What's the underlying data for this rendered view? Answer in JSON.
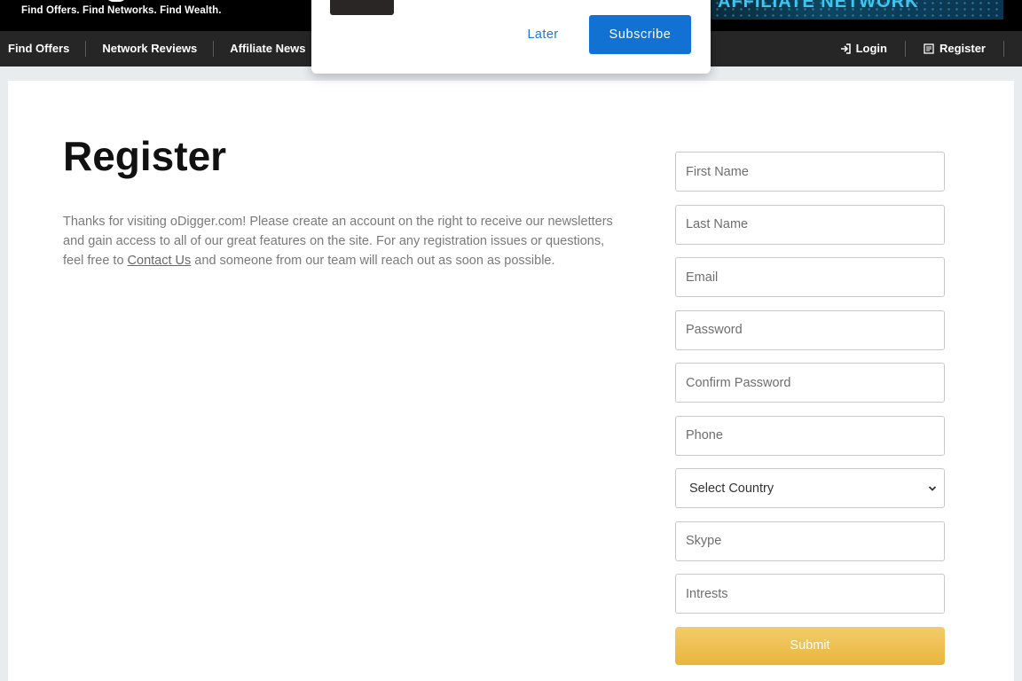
{
  "header": {
    "tagline": "Find Offers. Find Networks. Find Wealth.",
    "banner_text": "AFFILIATE NETWORK"
  },
  "nav": {
    "left": [
      {
        "label": "Find Offers"
      },
      {
        "label": "Network Reviews"
      },
      {
        "label": "Affiliate News"
      }
    ],
    "login_label": "Login",
    "register_label": "Register"
  },
  "popup": {
    "later_label": "Later",
    "subscribe_label": "Subscribe"
  },
  "page": {
    "title": "Register",
    "description_before": "Thanks for visiting oDigger.com! Please create an account on the right to receive our newsletters and gain access to all of our great features on the site. For any registration issues or questions, feel free to ",
    "contact_link": "Contact Us",
    "description_after": " and someone from our team will reach out as soon as possible."
  },
  "form": {
    "first_name_placeholder": "First Name",
    "last_name_placeholder": "Last Name",
    "email_placeholder": "Email",
    "password_placeholder": "Password",
    "confirm_password_placeholder": "Confirm Password",
    "phone_placeholder": "Phone",
    "country_selected": "Select Country",
    "skype_placeholder": "Skype",
    "interests_placeholder": "Intrests",
    "submit_label": "Submit"
  }
}
